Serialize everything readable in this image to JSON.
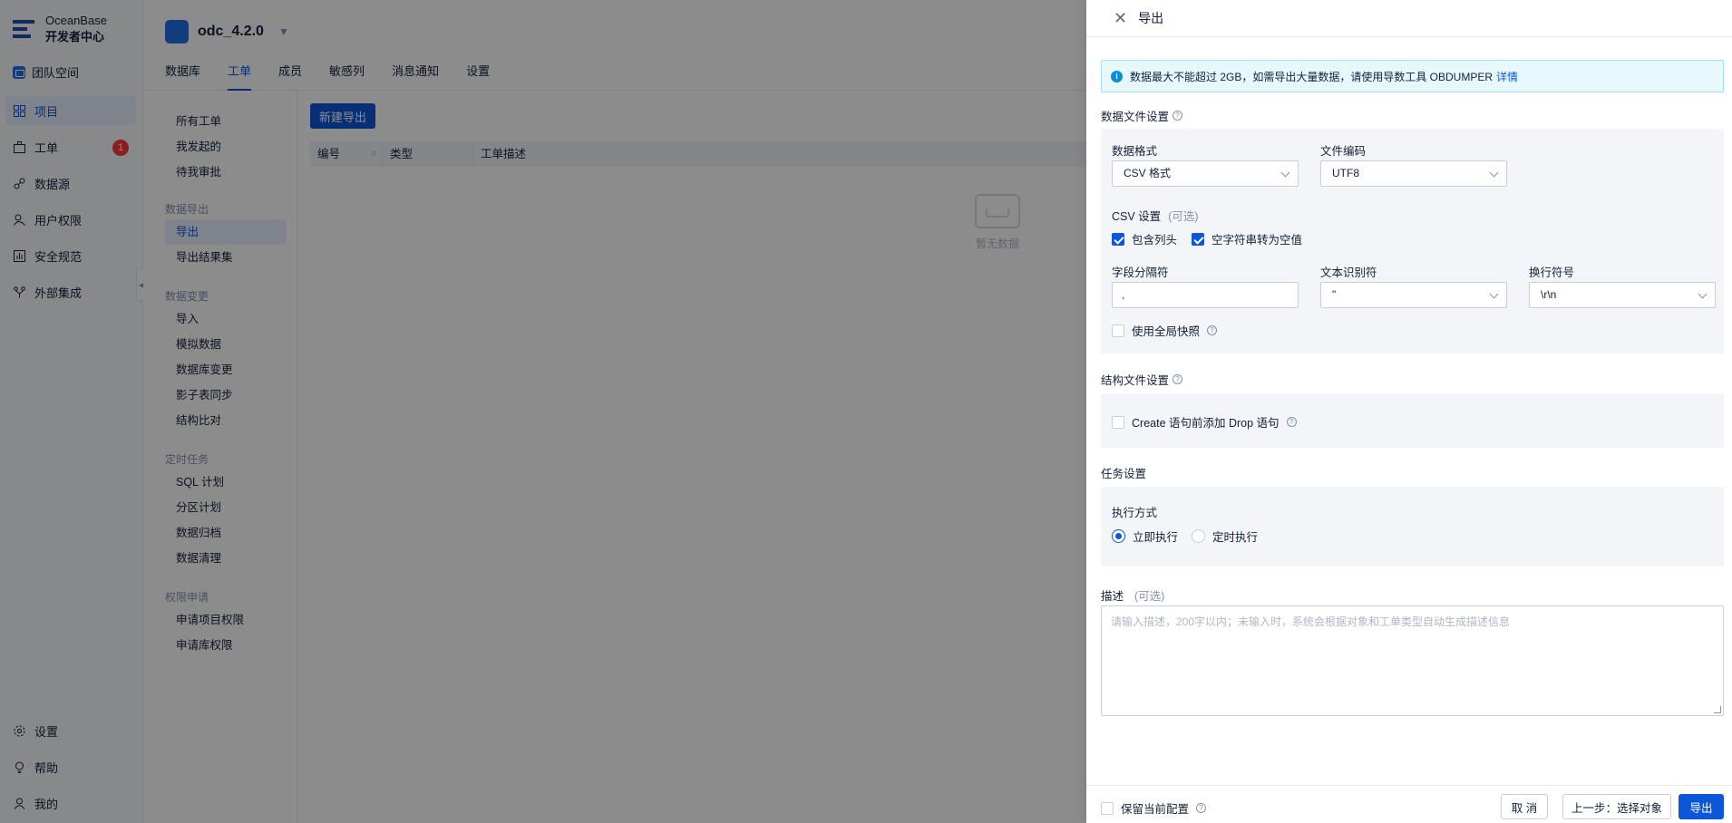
{
  "brand": {
    "line1": "OceanBase",
    "line2": "开发者中心"
  },
  "team_label": "团队空间",
  "left_nav": {
    "items": [
      {
        "label": "项目",
        "icon": "grid-icon",
        "active": true
      },
      {
        "label": "工单",
        "icon": "briefcase-icon",
        "badge": "1"
      },
      {
        "label": "数据源",
        "icon": "link-icon"
      },
      {
        "label": "用户权限",
        "icon": "user-key-icon"
      },
      {
        "label": "安全规范",
        "icon": "chart-icon"
      },
      {
        "label": "外部集成",
        "icon": "integration-icon"
      }
    ],
    "bottom": [
      {
        "label": "设置",
        "icon": "gear-icon"
      },
      {
        "label": "帮助",
        "icon": "bulb-icon"
      },
      {
        "label": "我的",
        "icon": "person-icon"
      }
    ]
  },
  "project": {
    "name": "odc_4.2.0",
    "tabs": [
      "数据库",
      "工单",
      "成员",
      "敏感列",
      "消息通知",
      "设置"
    ],
    "active_tab": "工单"
  },
  "ticket_nav": {
    "top_items": [
      "所有工单",
      "我发起的",
      "待我审批"
    ],
    "groups": [
      {
        "title": "数据导出",
        "items": [
          "导出",
          "导出结果集"
        ]
      },
      {
        "title": "数据变更",
        "items": [
          "导入",
          "模拟数据",
          "数据库变更",
          "影子表同步",
          "结构比对"
        ]
      },
      {
        "title": "定时任务",
        "items": [
          "SQL 计划",
          "分区计划",
          "数据归档",
          "数据清理"
        ]
      },
      {
        "title": "权限申请",
        "items": [
          "申请项目权限",
          "申请库权限"
        ]
      }
    ],
    "active_item": "导出"
  },
  "ticket_main": {
    "new_button": "新建导出",
    "columns": [
      "编号",
      "类型",
      "工单描述"
    ],
    "empty_text": "暂无数据"
  },
  "drawer": {
    "title": "导出",
    "alert": {
      "text": "数据最大不能超过 2GB，如需导出大量数据，请使用导数工具 OBDUMPER",
      "link": "详情"
    },
    "data_file_settings": {
      "title": "数据文件设置",
      "format_label": "数据格式",
      "format_value": "CSV 格式",
      "encoding_label": "文件编码",
      "encoding_value": "UTF8",
      "csv_title": "CSV 设置",
      "csv_optional": "(可选)",
      "include_header": "包含列头",
      "empty_to_null": "空字符串转为空值",
      "field_sep_label": "字段分隔符",
      "field_sep_value": ",",
      "text_qualifier_label": "文本识别符",
      "text_qualifier_value": "\"",
      "line_sep_label": "换行符号",
      "line_sep_value": "\\r\\n",
      "global_snapshot": "使用全局快照"
    },
    "structure_file_settings": {
      "title": "结构文件设置",
      "drop_option": "Create 语句前添加 Drop 语句"
    },
    "task_settings": {
      "title": "任务设置",
      "exec_label": "执行方式",
      "immediate": "立即执行",
      "scheduled": "定时执行"
    },
    "description": {
      "label": "描述",
      "optional": "(可选)",
      "placeholder": "请输入描述，200字以内；未输入时，系统会根据对象和工单类型自动生成描述信息"
    },
    "footer": {
      "keep_config": "保留当前配置",
      "cancel": "取 消",
      "prev": "上一步：选择对象",
      "submit": "导出"
    }
  },
  "colors": {
    "primary": "#0b56d9",
    "badge": "#f93939",
    "alert_bg": "#e8f8ff"
  }
}
